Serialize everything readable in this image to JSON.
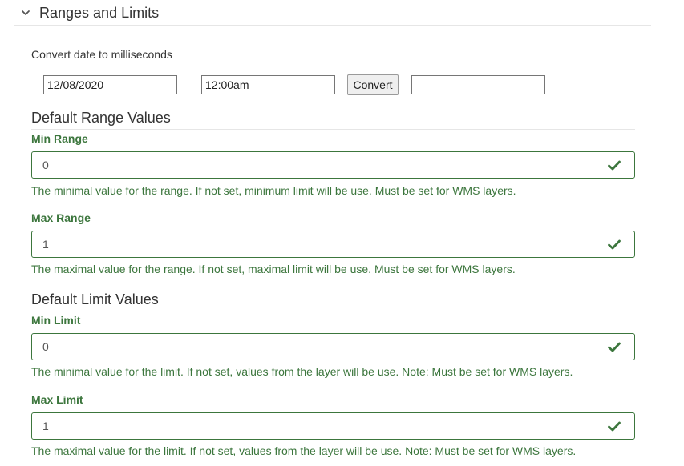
{
  "section": {
    "title": "Ranges and Limits",
    "toggle_icon": "chevron-down-icon"
  },
  "converter": {
    "label": "Convert date to milliseconds",
    "date_value": "12/08/2020",
    "time_value": "12:00am",
    "button_label": "Convert",
    "result_value": ""
  },
  "range": {
    "heading": "Default Range Values",
    "min": {
      "label": "Min Range",
      "value": "0",
      "help": "The minimal value for the range. If not set, minimum limit will be use. Must be set for WMS layers."
    },
    "max": {
      "label": "Max Range",
      "value": "1",
      "help": "The maximal value for the range. If not set, maximal limit will be use. Must be set for WMS layers."
    }
  },
  "limit": {
    "heading": "Default Limit Values",
    "min": {
      "label": "Min Limit",
      "value": "0",
      "help": "The minimal value for the limit. If not set, values from the layer will be use. Note: Must be set for WMS layers."
    },
    "max": {
      "label": "Max Limit",
      "value": "1",
      "help": "The maximal value for the limit. If not set, values from the layer will be use. Note: Must be set for WMS layers."
    }
  },
  "icons": {
    "valid": "check-icon"
  },
  "colors": {
    "valid_green": "#3c763d",
    "divider": "#e6e6e6",
    "text": "#333333"
  }
}
